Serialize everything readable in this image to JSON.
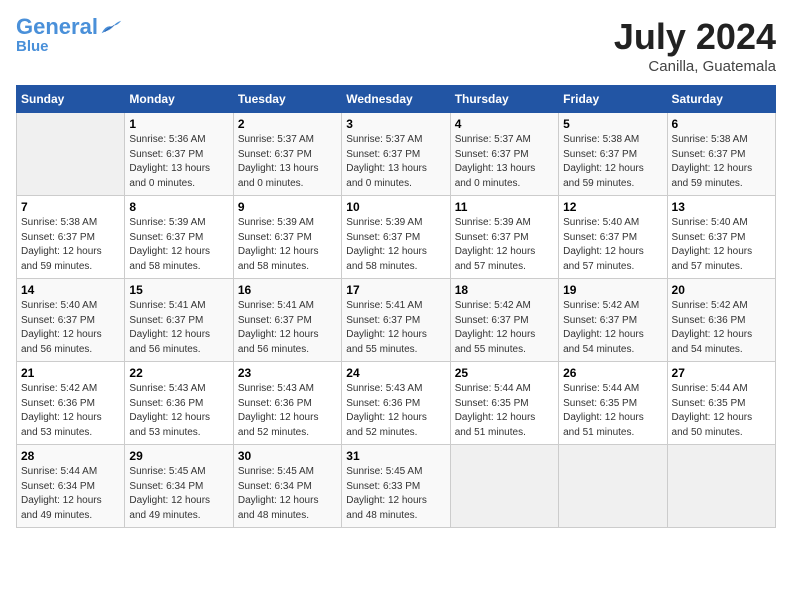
{
  "header": {
    "logo_general": "General",
    "logo_blue": "Blue",
    "month_title": "July 2024",
    "location": "Canilla, Guatemala"
  },
  "days_of_week": [
    "Sunday",
    "Monday",
    "Tuesday",
    "Wednesday",
    "Thursday",
    "Friday",
    "Saturday"
  ],
  "weeks": [
    [
      {
        "day": "",
        "info": ""
      },
      {
        "day": "1",
        "info": "Sunrise: 5:36 AM\nSunset: 6:37 PM\nDaylight: 13 hours\nand 0 minutes."
      },
      {
        "day": "2",
        "info": "Sunrise: 5:37 AM\nSunset: 6:37 PM\nDaylight: 13 hours\nand 0 minutes."
      },
      {
        "day": "3",
        "info": "Sunrise: 5:37 AM\nSunset: 6:37 PM\nDaylight: 13 hours\nand 0 minutes."
      },
      {
        "day": "4",
        "info": "Sunrise: 5:37 AM\nSunset: 6:37 PM\nDaylight: 13 hours\nand 0 minutes."
      },
      {
        "day": "5",
        "info": "Sunrise: 5:38 AM\nSunset: 6:37 PM\nDaylight: 12 hours\nand 59 minutes."
      },
      {
        "day": "6",
        "info": "Sunrise: 5:38 AM\nSunset: 6:37 PM\nDaylight: 12 hours\nand 59 minutes."
      }
    ],
    [
      {
        "day": "7",
        "info": "Sunrise: 5:38 AM\nSunset: 6:37 PM\nDaylight: 12 hours\nand 59 minutes."
      },
      {
        "day": "8",
        "info": "Sunrise: 5:39 AM\nSunset: 6:37 PM\nDaylight: 12 hours\nand 58 minutes."
      },
      {
        "day": "9",
        "info": "Sunrise: 5:39 AM\nSunset: 6:37 PM\nDaylight: 12 hours\nand 58 minutes."
      },
      {
        "day": "10",
        "info": "Sunrise: 5:39 AM\nSunset: 6:37 PM\nDaylight: 12 hours\nand 58 minutes."
      },
      {
        "day": "11",
        "info": "Sunrise: 5:39 AM\nSunset: 6:37 PM\nDaylight: 12 hours\nand 57 minutes."
      },
      {
        "day": "12",
        "info": "Sunrise: 5:40 AM\nSunset: 6:37 PM\nDaylight: 12 hours\nand 57 minutes."
      },
      {
        "day": "13",
        "info": "Sunrise: 5:40 AM\nSunset: 6:37 PM\nDaylight: 12 hours\nand 57 minutes."
      }
    ],
    [
      {
        "day": "14",
        "info": "Sunrise: 5:40 AM\nSunset: 6:37 PM\nDaylight: 12 hours\nand 56 minutes."
      },
      {
        "day": "15",
        "info": "Sunrise: 5:41 AM\nSunset: 6:37 PM\nDaylight: 12 hours\nand 56 minutes."
      },
      {
        "day": "16",
        "info": "Sunrise: 5:41 AM\nSunset: 6:37 PM\nDaylight: 12 hours\nand 56 minutes."
      },
      {
        "day": "17",
        "info": "Sunrise: 5:41 AM\nSunset: 6:37 PM\nDaylight: 12 hours\nand 55 minutes."
      },
      {
        "day": "18",
        "info": "Sunrise: 5:42 AM\nSunset: 6:37 PM\nDaylight: 12 hours\nand 55 minutes."
      },
      {
        "day": "19",
        "info": "Sunrise: 5:42 AM\nSunset: 6:37 PM\nDaylight: 12 hours\nand 54 minutes."
      },
      {
        "day": "20",
        "info": "Sunrise: 5:42 AM\nSunset: 6:36 PM\nDaylight: 12 hours\nand 54 minutes."
      }
    ],
    [
      {
        "day": "21",
        "info": "Sunrise: 5:42 AM\nSunset: 6:36 PM\nDaylight: 12 hours\nand 53 minutes."
      },
      {
        "day": "22",
        "info": "Sunrise: 5:43 AM\nSunset: 6:36 PM\nDaylight: 12 hours\nand 53 minutes."
      },
      {
        "day": "23",
        "info": "Sunrise: 5:43 AM\nSunset: 6:36 PM\nDaylight: 12 hours\nand 52 minutes."
      },
      {
        "day": "24",
        "info": "Sunrise: 5:43 AM\nSunset: 6:36 PM\nDaylight: 12 hours\nand 52 minutes."
      },
      {
        "day": "25",
        "info": "Sunrise: 5:44 AM\nSunset: 6:35 PM\nDaylight: 12 hours\nand 51 minutes."
      },
      {
        "day": "26",
        "info": "Sunrise: 5:44 AM\nSunset: 6:35 PM\nDaylight: 12 hours\nand 51 minutes."
      },
      {
        "day": "27",
        "info": "Sunrise: 5:44 AM\nSunset: 6:35 PM\nDaylight: 12 hours\nand 50 minutes."
      }
    ],
    [
      {
        "day": "28",
        "info": "Sunrise: 5:44 AM\nSunset: 6:34 PM\nDaylight: 12 hours\nand 49 minutes."
      },
      {
        "day": "29",
        "info": "Sunrise: 5:45 AM\nSunset: 6:34 PM\nDaylight: 12 hours\nand 49 minutes."
      },
      {
        "day": "30",
        "info": "Sunrise: 5:45 AM\nSunset: 6:34 PM\nDaylight: 12 hours\nand 48 minutes."
      },
      {
        "day": "31",
        "info": "Sunrise: 5:45 AM\nSunset: 6:33 PM\nDaylight: 12 hours\nand 48 minutes."
      },
      {
        "day": "",
        "info": ""
      },
      {
        "day": "",
        "info": ""
      },
      {
        "day": "",
        "info": ""
      }
    ]
  ]
}
